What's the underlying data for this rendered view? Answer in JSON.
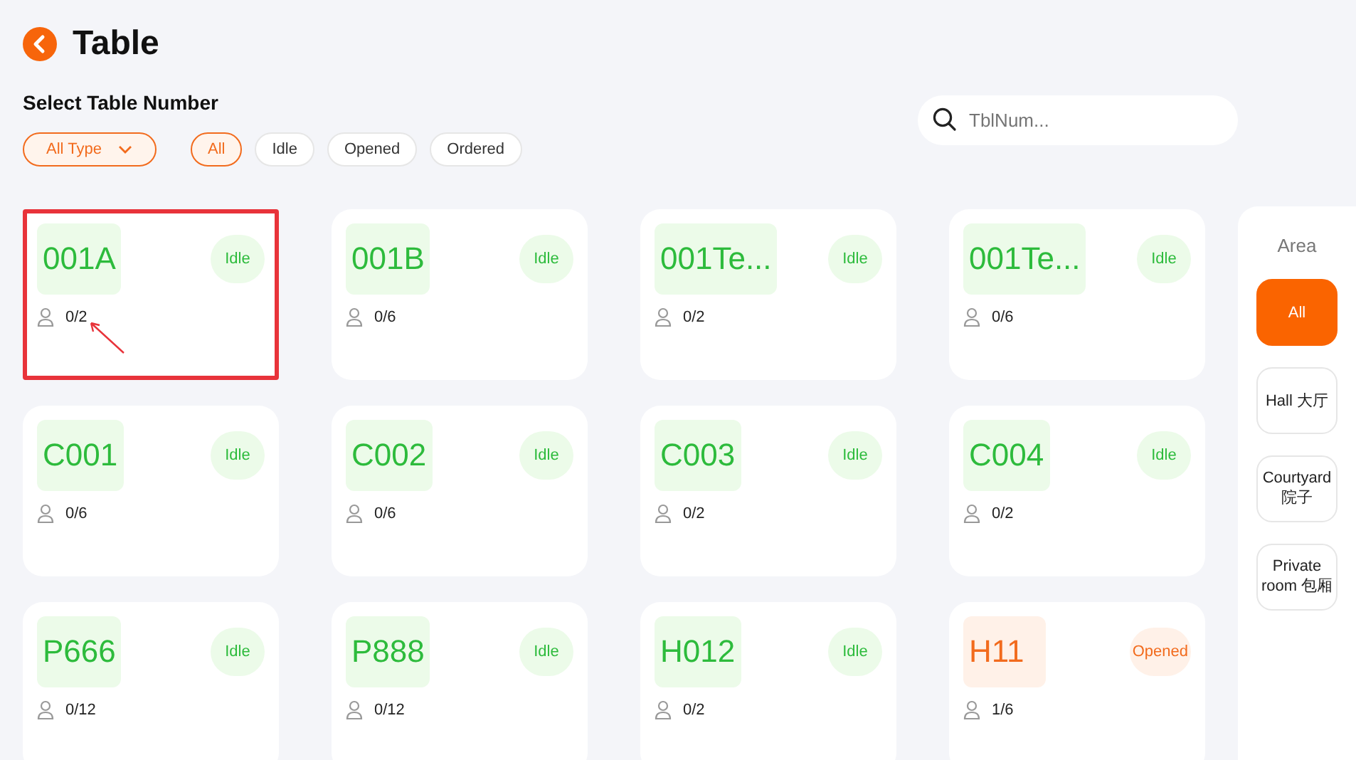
{
  "header": {
    "title": "Table"
  },
  "subtitle": "Select Table Number",
  "type_dropdown": {
    "value": "All Type"
  },
  "status_filters": [
    {
      "label": "All",
      "selected": true
    },
    {
      "label": "Idle",
      "selected": false
    },
    {
      "label": "Opened",
      "selected": false
    },
    {
      "label": "Ordered",
      "selected": false
    }
  ],
  "search": {
    "placeholder": "TblNum..."
  },
  "tables": [
    {
      "number": "001A",
      "status": "Idle",
      "kind": "idle",
      "guests": "0/2",
      "highlighted": true
    },
    {
      "number": "001B",
      "status": "Idle",
      "kind": "idle",
      "guests": "0/6",
      "highlighted": false
    },
    {
      "number": "001Te...",
      "status": "Idle",
      "kind": "idle",
      "guests": "0/2",
      "highlighted": false
    },
    {
      "number": "001Te...",
      "status": "Idle",
      "kind": "idle",
      "guests": "0/6",
      "highlighted": false
    },
    {
      "number": "C001",
      "status": "Idle",
      "kind": "idle",
      "guests": "0/6",
      "highlighted": false
    },
    {
      "number": "C002",
      "status": "Idle",
      "kind": "idle",
      "guests": "0/6",
      "highlighted": false
    },
    {
      "number": "C003",
      "status": "Idle",
      "kind": "idle",
      "guests": "0/2",
      "highlighted": false
    },
    {
      "number": "C004",
      "status": "Idle",
      "kind": "idle",
      "guests": "0/2",
      "highlighted": false
    },
    {
      "number": "P666",
      "status": "Idle",
      "kind": "idle",
      "guests": "0/12",
      "highlighted": false
    },
    {
      "number": "P888",
      "status": "Idle",
      "kind": "idle",
      "guests": "0/12",
      "highlighted": false
    },
    {
      "number": "H012",
      "status": "Idle",
      "kind": "idle",
      "guests": "0/2",
      "highlighted": false
    },
    {
      "number": "H11",
      "status": "Opened",
      "kind": "opened",
      "guests": "1/6",
      "highlighted": false
    }
  ],
  "area": {
    "title": "Area",
    "items": [
      {
        "label": "All",
        "selected": true
      },
      {
        "label": "Hall 大厅",
        "selected": false
      },
      {
        "label": "Courtyard 院子",
        "selected": false
      },
      {
        "label": "Private room 包厢",
        "selected": false
      }
    ]
  }
}
